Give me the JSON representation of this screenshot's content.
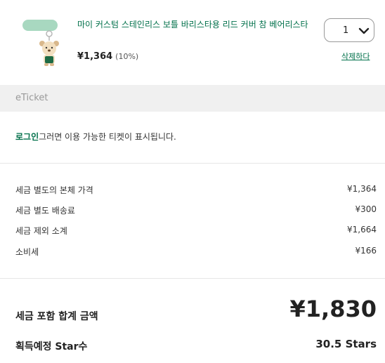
{
  "cart_item": {
    "product_name": "마이 커스텀 스테인리스 보틀 바리스타용 리드 커버 참 베어리스타",
    "price": "¥1,364",
    "discount": "(10%)",
    "quantity": "1",
    "delete_label": "삭제하다"
  },
  "eticket": {
    "title": "eTicket",
    "login_link": "로그인",
    "message": "그러면 이용 가능한 티켓이 표시됩니다."
  },
  "summary": {
    "rows": [
      {
        "label": "세금 별도의 본체 가격",
        "value": "¥1,364"
      },
      {
        "label": "세금 별도 배송료",
        "value": "¥300"
      },
      {
        "label": "세금 제외 소계",
        "value": "¥1,664"
      },
      {
        "label": "소비세",
        "value": "¥166"
      }
    ],
    "total_label": "세금 포함 합계 금액",
    "total_value": "¥1,830",
    "stars_label": "획득예정 Star수",
    "stars_value": "30.5 Stars"
  },
  "colors": {
    "accent": "#00704a",
    "bar": "#f0f0f0",
    "lid": "#a8d8c0"
  }
}
